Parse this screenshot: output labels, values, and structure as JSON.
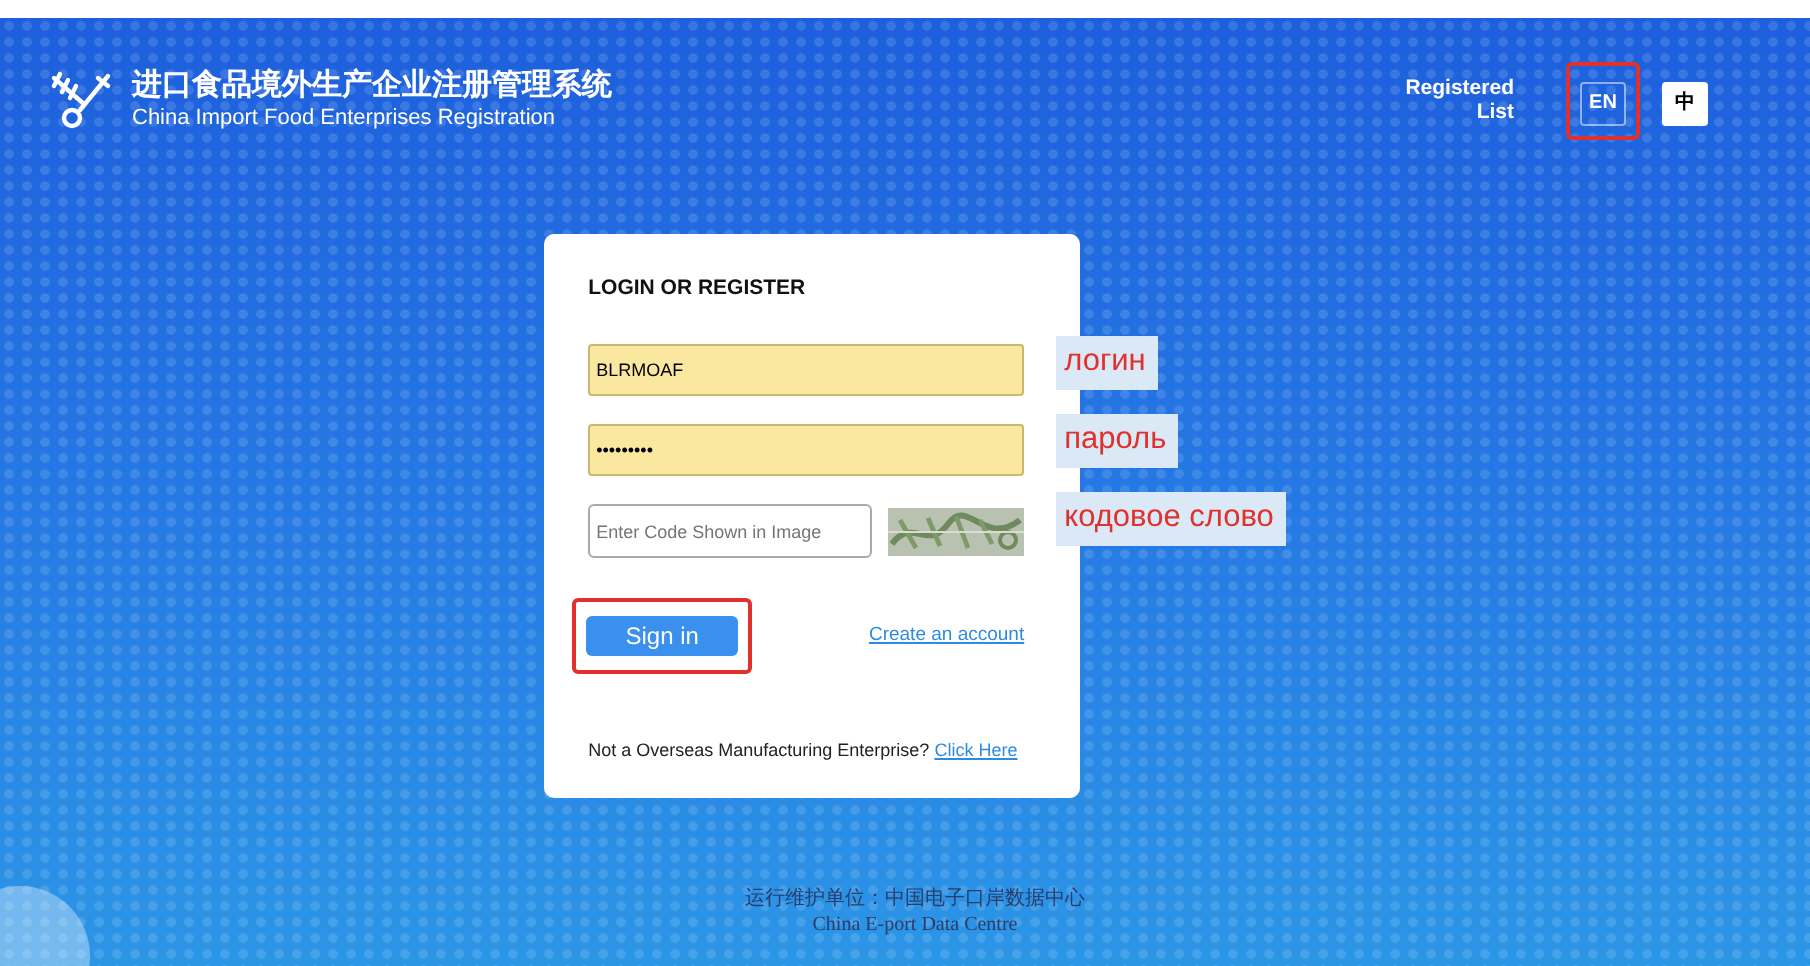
{
  "header": {
    "title": "进口食品境外生产企业注册管理系统",
    "subtitle": "China Import Food Enterprises Registration",
    "nav_link": "Registered\nList",
    "languages": [
      {
        "label": "EN",
        "selected": true,
        "highlighted": true
      },
      {
        "label": "中",
        "selected": false,
        "highlighted": false
      }
    ]
  },
  "login": {
    "title": "LOGIN OR REGISTER",
    "username": {
      "value": "BLRMOAF",
      "autofilled": true
    },
    "password": {
      "value": "•••••••••",
      "autofilled": true
    },
    "captcha": {
      "placeholder": "Enter Code Shown in Image"
    },
    "sign_in": {
      "label": "Sign in",
      "highlighted": true
    },
    "create_account": "Create an account",
    "note": "Not a Overseas Manufacturing Enterprise?",
    "note_link": "Click Here"
  },
  "annotations": [
    "логин",
    "пароль",
    "кодовое слово"
  ],
  "footer": {
    "line_1": "运行维护单位：中国电子口岸数据中心",
    "line_2": "China E-port Data Centre"
  }
}
